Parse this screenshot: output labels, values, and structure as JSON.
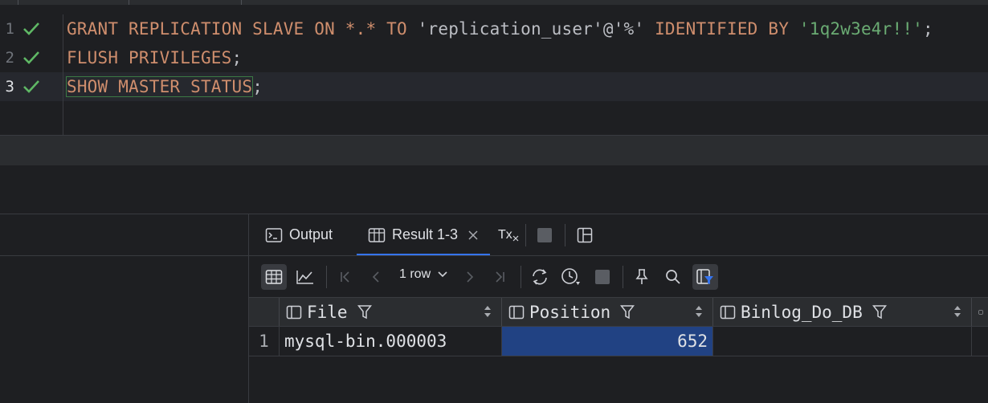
{
  "editor": {
    "lines": [
      {
        "number": "1",
        "status": "executed"
      },
      {
        "number": "2",
        "status": "executed"
      },
      {
        "number": "3",
        "status": "executed"
      }
    ],
    "line1": {
      "kw1": "GRANT REPLICATION SLAVE ON ",
      "star": "*.*",
      "kw2": " TO ",
      "user": "'replication_user'",
      "at": "@",
      "host": "'%'",
      "kw3": " IDENTIFIED BY ",
      "pwd": "'1q2w3e4r!!'",
      "semi": ";"
    },
    "line2": {
      "kw": "FLUSH PRIVILEGES",
      "semi": ";"
    },
    "line3": {
      "kw": "SHOW MASTER STATUS",
      "semi": ";"
    }
  },
  "tabs": [
    {
      "label": "Output",
      "icon": "console-icon"
    },
    {
      "label": "Result 1-3",
      "icon": "table-icon",
      "active": true,
      "closable": true
    }
  ],
  "toolbar": {
    "rows_label": "1 row",
    "tx_label": "Tx"
  },
  "grid": {
    "columns": [
      "File",
      "Position",
      "Binlog_Do_DB"
    ],
    "rows": [
      {
        "num": "1",
        "File": "mysql-bin.000003",
        "Position": "652",
        "Binlog_Do_DB": ""
      }
    ]
  },
  "colors": {
    "keyword": "#cf8e6d",
    "string_green": "#6aab73",
    "check": "#5fb865",
    "selection": "#214283",
    "accent": "#3574f0"
  }
}
